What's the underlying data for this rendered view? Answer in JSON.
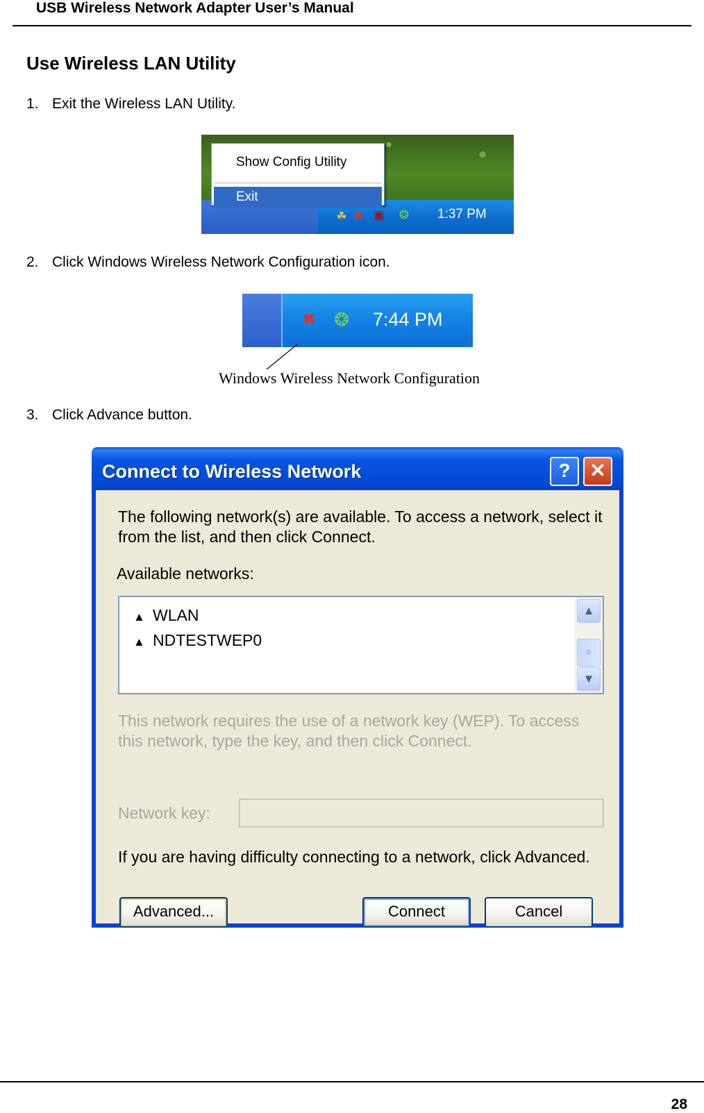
{
  "header": {
    "title": "USB Wireless Network Adapter User’s Manual"
  },
  "section": {
    "title": "Use Wireless LAN Utility"
  },
  "steps": [
    {
      "num": "1.",
      "text": "Exit the Wireless LAN Utility."
    },
    {
      "num": "2.",
      "text": "Click Windows Wireless Network Configuration icon."
    },
    {
      "num": "3.",
      "text": "Click Advance button."
    }
  ],
  "screenshot1": {
    "menu_items": [
      "Show Config Utility",
      "Exit"
    ],
    "clock": "1:37 PM"
  },
  "screenshot2": {
    "clock": "7:44 PM",
    "callout_label": "Windows Wireless Network Configuration"
  },
  "dialog": {
    "title": "Connect to Wireless Network",
    "intro": "The following network(s) are available. To access a network, select it from the list, and then click Connect.",
    "available_label": "Available networks:",
    "networks": [
      "WLAN",
      "NDTESTWEP0"
    ],
    "wep_note": "This network requires the use of a network key (WEP). To access this network, type the key, and then click Connect.",
    "key_label": "Network key:",
    "key_value": "",
    "difficulty": "If you are having difficulty connecting to a network, click Advanced.",
    "buttons": {
      "advanced": "Advanced...",
      "connect": "Connect",
      "cancel": "Cancel"
    }
  },
  "footer": {
    "page_number": "28"
  }
}
